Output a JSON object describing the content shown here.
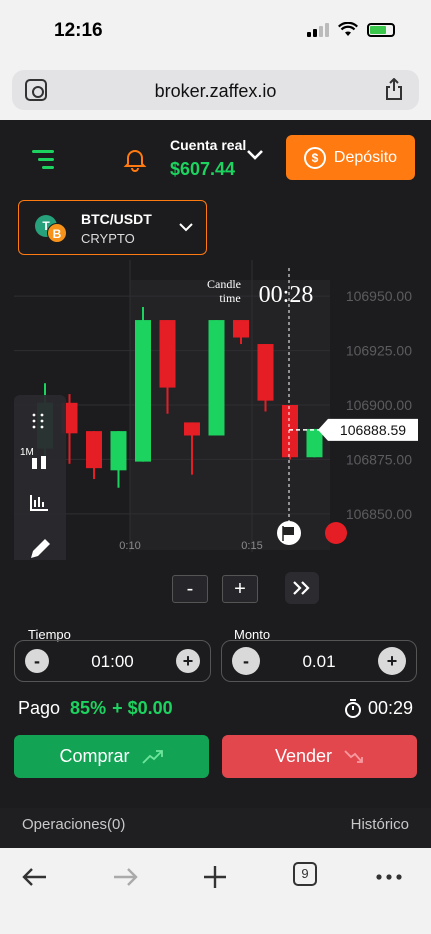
{
  "status_bar": {
    "time": "12:16"
  },
  "browser": {
    "url": "broker.zaffex.io",
    "tab_count": "9"
  },
  "header": {
    "account_label": "Cuenta real",
    "balance": "$607.44",
    "deposit_label": "Depósito"
  },
  "asset": {
    "name": "BTC/USDT",
    "type": "CRYPTO"
  },
  "chart_data": {
    "type": "candlestick",
    "timeframe": "1M",
    "candle_time_label": "Candle time",
    "countdown": "00:28",
    "current_price": "106888.59",
    "y_ticks": [
      "106950.00",
      "106925.00",
      "106900.00",
      "106875.00",
      "106850.00"
    ],
    "ylim": [
      106838,
      106962
    ],
    "x_ticks": [
      "0:10",
      "0:15"
    ],
    "candles": [
      {
        "o": 106880,
        "h": 106910,
        "l": 106870,
        "c": 106901,
        "dir": "up"
      },
      {
        "o": 106901,
        "h": 106905,
        "l": 106873,
        "c": 106887,
        "dir": "down"
      },
      {
        "o": 106888,
        "h": 106888,
        "l": 106866,
        "c": 106871,
        "dir": "down"
      },
      {
        "o": 106870,
        "h": 106888,
        "l": 106862,
        "c": 106888,
        "dir": "up"
      },
      {
        "o": 106874,
        "h": 106945,
        "l": 106874,
        "c": 106939,
        "dir": "up"
      },
      {
        "o": 106939,
        "h": 106939,
        "l": 106896,
        "c": 106908,
        "dir": "down"
      },
      {
        "o": 106892,
        "h": 106892,
        "l": 106868,
        "c": 106886,
        "dir": "down"
      },
      {
        "o": 106886,
        "h": 106939,
        "l": 106886,
        "c": 106939,
        "dir": "up"
      },
      {
        "o": 106939,
        "h": 106939,
        "l": 106928,
        "c": 106931,
        "dir": "down"
      },
      {
        "o": 106928,
        "h": 106928,
        "l": 106897,
        "c": 106902,
        "dir": "down"
      },
      {
        "o": 106900,
        "h": 106900,
        "l": 106875,
        "c": 106876,
        "dir": "down"
      },
      {
        "o": 106876,
        "h": 106889,
        "l": 106876,
        "c": 106889,
        "dir": "up"
      }
    ],
    "up_color": "#1dd35f",
    "down_color": "#e51e25"
  },
  "tools": {
    "timeframe_label": "1M"
  },
  "controls": {
    "time_label": "Tiempo",
    "time_value": "01:00",
    "amount_label": "Monto",
    "amount_value": "0.01",
    "payout_label": "Pago",
    "payout_percent": "85%",
    "payout_amount": "+ $0.00",
    "countdown": "00:29",
    "buy_label": "Comprar",
    "sell_label": "Vender",
    "minus": "-",
    "plus": "+"
  },
  "bottom_tabs": {
    "operations": "Operaciones(0)",
    "history": "Histórico"
  },
  "colors": {
    "accent": "#ff7a10",
    "green": "#1dd35f",
    "buy": "#12a454",
    "sell": "#e3474e",
    "background": "#1c1c1e"
  }
}
